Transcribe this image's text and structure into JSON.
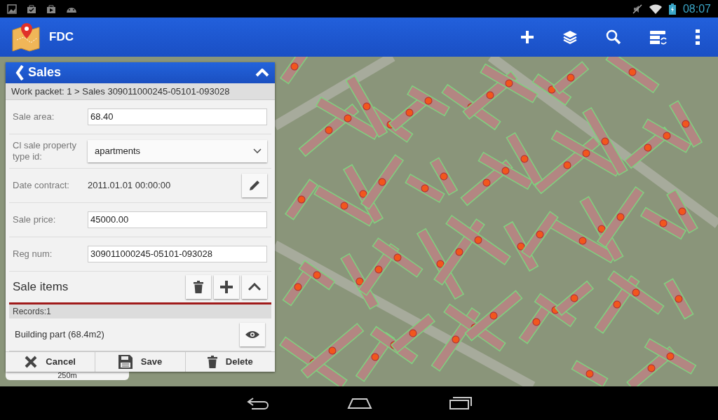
{
  "status_bar": {
    "time": "08:07"
  },
  "app_bar": {
    "title": "FDC"
  },
  "map": {
    "scale": "250m"
  },
  "panel": {
    "title": "Sales",
    "breadcrumb": "Work packet: 1 > Sales 309011000245-05101-093028",
    "fields": [
      {
        "kind": "input",
        "label": "Sale area:",
        "value": "68.40"
      },
      {
        "kind": "select",
        "label": "Cl sale property type id:",
        "value": "apartments"
      },
      {
        "kind": "date",
        "label": "Date contract:",
        "value": "2011.01.01 00:00:00"
      },
      {
        "kind": "input",
        "label": "Sale price:",
        "value": "45000.00"
      },
      {
        "kind": "input",
        "label": "Reg num:",
        "value": "309011000245-05101-093028"
      }
    ],
    "section": {
      "title": "Sale items",
      "records": "Records:1",
      "items": [
        "Building part (68.4m2)"
      ]
    },
    "footer_buttons": [
      {
        "kind": "cancel",
        "label": "Cancel"
      },
      {
        "kind": "save",
        "label": "Save"
      },
      {
        "kind": "delete",
        "label": "Delete"
      }
    ]
  }
}
